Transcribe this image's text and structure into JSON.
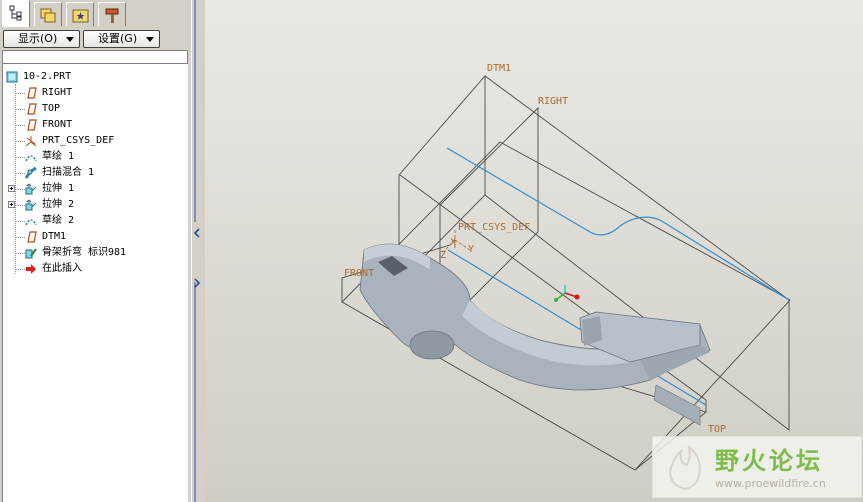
{
  "toolbar": {
    "display_label": "显示(O)",
    "settings_label": "设置(G)"
  },
  "tree": {
    "items": [
      {
        "label": "10-2.PRT",
        "icon": "part-icon"
      },
      {
        "label": "RIGHT",
        "icon": "datum-plane-icon"
      },
      {
        "label": "TOP",
        "icon": "datum-plane-icon"
      },
      {
        "label": "FRONT",
        "icon": "datum-plane-icon"
      },
      {
        "label": "PRT_CSYS_DEF",
        "icon": "coordinate-system-icon"
      },
      {
        "label": "草绘 1",
        "icon": "sketch-icon"
      },
      {
        "label": "扫描混合 1",
        "icon": "swept-blend-icon"
      },
      {
        "label": "拉伸 1",
        "icon": "extrude-icon",
        "expandable": true
      },
      {
        "label": "拉伸 2",
        "icon": "extrude-icon",
        "expandable": true
      },
      {
        "label": "草绘 2",
        "icon": "sketch-icon"
      },
      {
        "label": "DTM1",
        "icon": "datum-plane-icon"
      },
      {
        "label": "骨架折弯 标识981",
        "icon": "spinal-bend-icon"
      },
      {
        "label": "在此插入",
        "icon": "insert-here-arrow-icon"
      }
    ]
  },
  "viewport": {
    "labels": {
      "dtm1": "DTM1",
      "right": "RIGHT",
      "csys": "PRT_CSYS_DEF",
      "front": "FRONT",
      "top": "TOP",
      "axis_x": "X",
      "axis_y": "Y",
      "axis_z": "Z"
    }
  },
  "watermark": {
    "title": "野火论坛",
    "url": "www.proewildfire.cn"
  },
  "colors": {
    "datum_label": "#b06a2a",
    "part_fill": "#b4bcc6",
    "sketch_curve": "#2f8fd6",
    "watermark_green": "#7dbb4a"
  }
}
